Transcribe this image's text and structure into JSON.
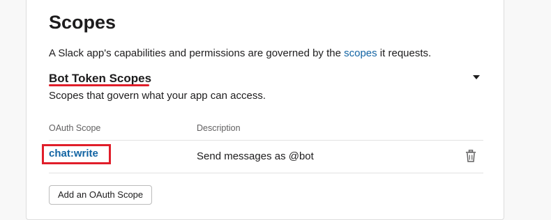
{
  "scopes_section": {
    "title": "Scopes",
    "intro_prefix": "A Slack app's capabilities and permissions are governed by the ",
    "intro_link": "scopes",
    "intro_suffix": " it requests."
  },
  "bot_token": {
    "title": "Bot Token Scopes",
    "subtitle": "Scopes that govern what your app can access.",
    "columns": {
      "scope": "OAuth Scope",
      "description": "Description"
    },
    "rows": [
      {
        "scope": "chat:write",
        "description": "Send messages as @bot"
      }
    ],
    "add_button": "Add an OAuth Scope"
  },
  "colors": {
    "link": "#1264a3",
    "annotation": "#e01e2a"
  }
}
